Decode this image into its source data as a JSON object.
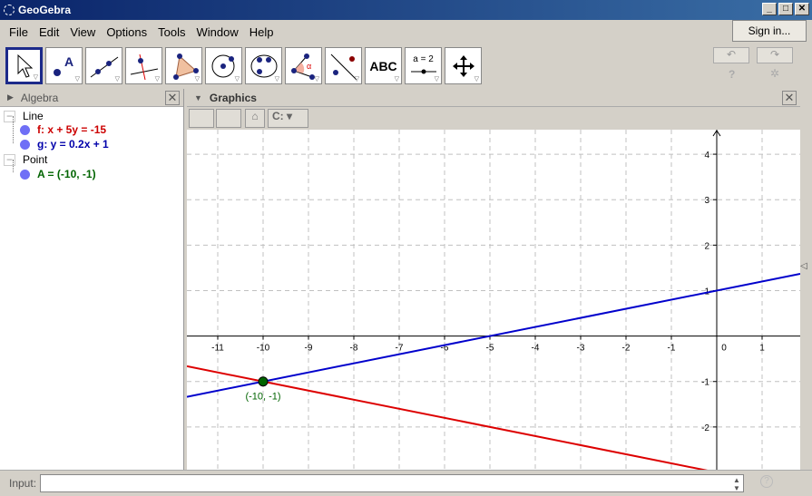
{
  "window": {
    "title": "GeoGebra"
  },
  "menu": [
    "File",
    "Edit",
    "View",
    "Options",
    "Tools",
    "Window",
    "Help"
  ],
  "sign_in": "Sign in...",
  "toolbar": {
    "tools": [
      "move-tool",
      "point-tool",
      "line-tool",
      "perpendicular-line-tool",
      "polygon-tool",
      "circle-center-tool",
      "conic-tool",
      "angle-tool",
      "reflect-tool",
      "text-tool",
      "slider-tool",
      "move-graphics-tool"
    ],
    "text_label": "ABC",
    "slider_label": "a = 2",
    "help": "?",
    "undo": "↶",
    "redo": "↷"
  },
  "algebra": {
    "title": "Algebra",
    "groups": [
      {
        "label": "Line",
        "items": [
          {
            "text": "f: x + 5y = -15",
            "color": "#cc0000"
          },
          {
            "text": "g: y = 0.2x + 1",
            "color": "#0000aa"
          }
        ]
      },
      {
        "label": "Point",
        "items": [
          {
            "text": "A = (-10, -1)",
            "color": "#006400"
          }
        ]
      }
    ]
  },
  "graphics": {
    "title": "Graphics",
    "point_label": "(-10, -1)"
  },
  "input": {
    "label": "Input:",
    "value": ""
  },
  "chart_data": {
    "type": "line",
    "xlim": [
      -11.68,
      1.84
    ],
    "ylim": [
      -2.94,
      4.54
    ],
    "grid": true,
    "xticks": [
      -11,
      -10,
      -9,
      -8,
      -7,
      -6,
      -5,
      -4,
      -3,
      -2,
      -1,
      0,
      1
    ],
    "yticks": [
      -2,
      -1,
      1,
      2,
      3,
      4
    ],
    "lines": [
      {
        "name": "f",
        "a": 1,
        "b": 5,
        "c": -15,
        "color": "#dd0000"
      },
      {
        "name": "g",
        "slope": 0.2,
        "intercept": 1,
        "color": "#0000cc"
      }
    ],
    "points": [
      {
        "name": "A",
        "x": -10,
        "y": -1,
        "color": "#006400"
      }
    ]
  }
}
